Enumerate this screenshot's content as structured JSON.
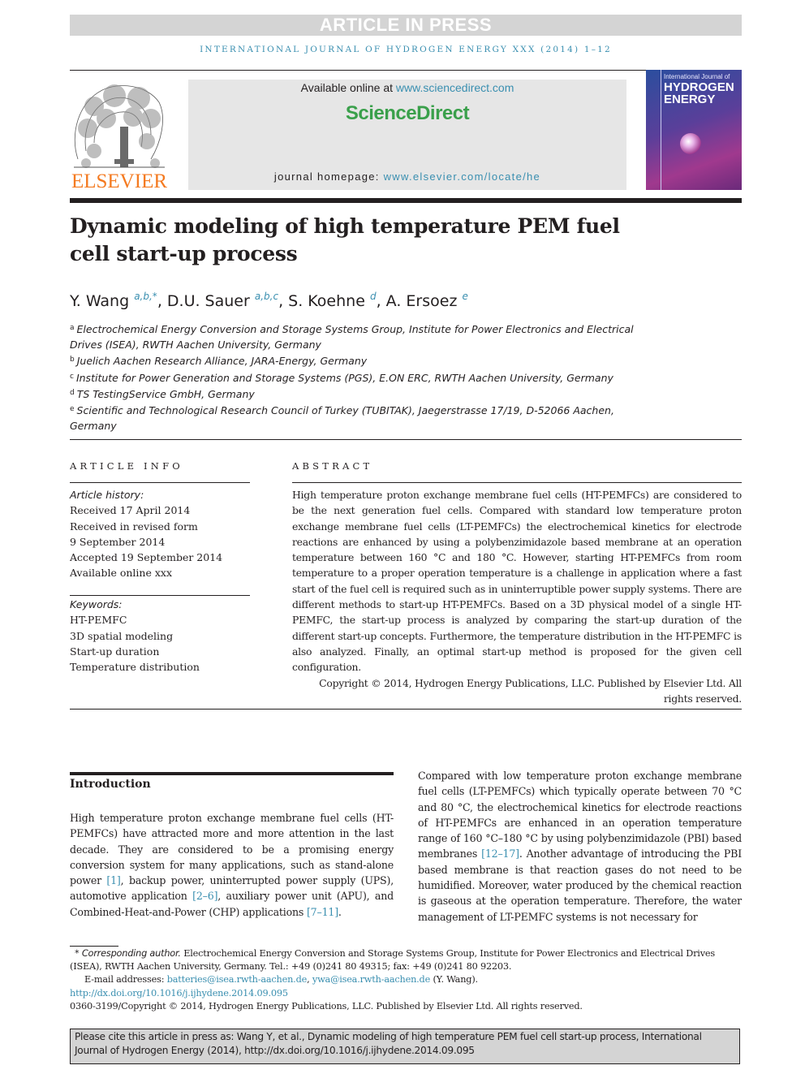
{
  "banner": {
    "text": "ARTICLE IN PRESS"
  },
  "running_header": "INTERNATIONAL JOURNAL OF HYDROGEN ENERGY XXX (2014) 1–12",
  "publisher": {
    "logo_word": "ELSEVIER",
    "logo_icon": "elsevier-tree-icon",
    "available_prefix": "Available online at ",
    "available_link": "www.sciencedirect.com",
    "platform_name": "ScienceDirect",
    "homepage_prefix": "journal homepage: ",
    "homepage_link": "www.elsevier.com/locate/he",
    "brand_colors": {
      "elsevier": "#f47a20",
      "sciencedirect": "#3aa04b",
      "link": "#3a8fb0"
    }
  },
  "cover": {
    "line1": "International Journal of",
    "line2": "HYDROGEN",
    "line3": "ENERGY"
  },
  "article": {
    "title": "Dynamic modeling of high temperature PEM fuel cell start-up process",
    "authors": [
      {
        "name": "Y. Wang",
        "affil": "a,b,*"
      },
      {
        "name": "D.U. Sauer",
        "affil": "a,b,c"
      },
      {
        "name": "S. Koehne",
        "affil": "d"
      },
      {
        "name": "A. Ersoez",
        "affil": "e"
      }
    ],
    "affiliations": [
      {
        "key": "a",
        "text": "Electrochemical Energy Conversion and Storage Systems Group, Institute for Power Electronics and Electrical Drives (ISEA), RWTH Aachen University, Germany"
      },
      {
        "key": "b",
        "text": "Juelich Aachen Research Alliance, JARA-Energy, Germany"
      },
      {
        "key": "c",
        "text": "Institute for Power Generation and Storage Systems (PGS), E.ON ERC, RWTH Aachen University, Germany"
      },
      {
        "key": "d",
        "text": "TS TestingService GmbH, Germany"
      },
      {
        "key": "e",
        "text": "Scientific and Technological Research Council of Turkey (TUBITAK), Jaegerstrasse 17/19, D-52066 Aachen, Germany"
      }
    ]
  },
  "article_info": {
    "heading": "ARTICLE INFO",
    "history_label": "Article history:",
    "history": [
      "Received 17 April 2014",
      "Received in revised form",
      "9 September 2014",
      "Accepted 19 September 2014",
      "Available online xxx"
    ],
    "keywords_label": "Keywords:",
    "keywords": [
      "HT-PEMFC",
      "3D spatial modeling",
      "Start-up duration",
      "Temperature distribution"
    ]
  },
  "abstract": {
    "heading": "ABSTRACT",
    "text": "High temperature proton exchange membrane fuel cells (HT-PEMFCs) are considered to be the next generation fuel cells. Compared with standard low temperature proton exchange membrane fuel cells (LT-PEMFCs) the electrochemical kinetics for electrode reactions are enhanced by using a polybenzimidazole based membrane at an operation temperature between 160 °C and 180 °C. However, starting HT-PEMFCs from room temperature to a proper operation temperature is a challenge in application where a fast start of the fuel cell is required such as in uninterruptible power supply systems. There are different methods to start-up HT-PEMFCs. Based on a 3D physical model of a single HT-PEMFC, the start-up process is analyzed by comparing the start-up duration of the different start-up concepts. Furthermore, the temperature distribution in the HT-PEMFC is also analyzed. Finally, an optimal start-up method is proposed for the given cell configuration.",
    "copyright": "Copyright © 2014, Hydrogen Energy Publications, LLC. Published by Elsevier Ltd. All rights reserved."
  },
  "body": {
    "intro_heading": "Introduction",
    "col1": [
      {
        "t": "High temperature proton exchange membrane fuel cells (HT-PEMFCs) have attracted more and more attention in the last decade. They are considered to be a promising energy conversion system for many applications, such as stand-alone power "
      },
      {
        "ref": "[1]"
      },
      {
        "t": ", backup power, uninterrupted power supply (UPS), automotive application "
      },
      {
        "ref": "[2–6]"
      },
      {
        "t": ", auxiliary power unit (APU), and Combined-Heat-and-Power (CHP) applications "
      },
      {
        "ref": "[7–11]"
      },
      {
        "t": "."
      }
    ],
    "col2": [
      {
        "t": "Compared with low temperature proton exchange membrane fuel cells (LT-PEMFCs) which typically operate between 70 °C and 80 °C, the electrochemical kinetics for electrode reactions of HT-PEMFCs are enhanced in an operation temperature range of 160 °C–180 °C by using polybenzimidazole (PBI) based membranes "
      },
      {
        "ref": "[12–17]"
      },
      {
        "t": ". Another advantage of introducing the PBI based membrane is that reaction gases do not need to be humidified. Moreover, water produced by the chemical reaction is gaseous at the operation temperature. Therefore, the water management of LT-PEMFC systems is not necessary for"
      }
    ]
  },
  "footnotes": {
    "corresponding_label": "* Corresponding author.",
    "corresponding_text": " Electrochemical Energy Conversion and Storage Systems Group, Institute for Power Electronics and Electrical Drives (ISEA), RWTH Aachen University, Germany. Tel.: +49 (0)241 80 49315; fax: +49 (0)241 80 92203.",
    "email_label": "E-mail addresses: ",
    "email1": "batteries@isea.rwth-aachen.de",
    "email_sep": ", ",
    "email2": "ywa@isea.rwth-aachen.de",
    "email_suffix": " (Y. Wang).",
    "doi": "http://dx.doi.org/10.1016/j.ijhydene.2014.09.095",
    "issn_copyright": "0360-3199/Copyright © 2014, Hydrogen Energy Publications, LLC. Published by Elsevier Ltd. All rights reserved."
  },
  "cite_box": "Please cite this article in press as: Wang Y, et al., Dynamic modeling of high temperature PEM fuel cell start-up process, International Journal of Hydrogen Energy (2014), http://dx.doi.org/10.1016/j.ijhydene.2014.09.095"
}
